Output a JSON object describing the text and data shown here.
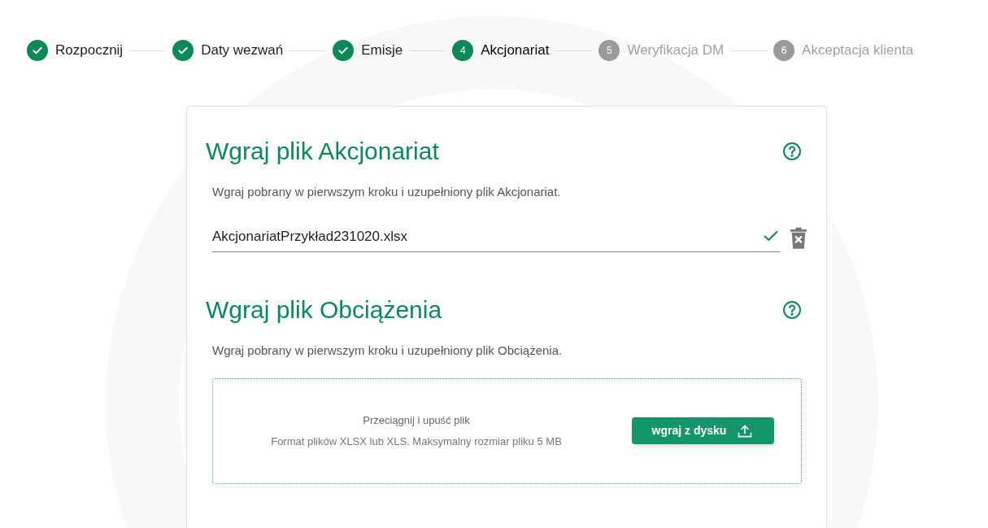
{
  "steps": [
    {
      "label": "Rozpocznij",
      "kind": "done"
    },
    {
      "label": "Daty wezwań",
      "kind": "done"
    },
    {
      "label": "Emisje",
      "kind": "done"
    },
    {
      "number": "4",
      "label": "Akcjonariat",
      "kind": "current"
    },
    {
      "number": "5",
      "label": "Weryfikacja DM",
      "kind": "pending"
    },
    {
      "number": "6",
      "label": "Akceptacja klienta",
      "kind": "pending"
    }
  ],
  "sections": [
    {
      "kind": "uploaded",
      "title": "Wgraj plik Akcjonariat",
      "description": "Wgraj pobrany w pierwszym kroku i uzupełniony plik Akcjonariat.",
      "file_name": "AkcjonariatPrzykład231020.xlsx",
      "valid": true
    },
    {
      "kind": "dropzone",
      "title": "Wgraj plik Obciążenia",
      "description": "Wgraj pobrany w pierwszym kroku i uzupełniony plik Obciążenia.",
      "drop_text": "Przeciągnij i upuść plik",
      "format_text": "Format plików XLSX lub XLS. Maksymalny rozmiar pliku 5 MB",
      "button": "wgraj z dysku"
    }
  ]
}
